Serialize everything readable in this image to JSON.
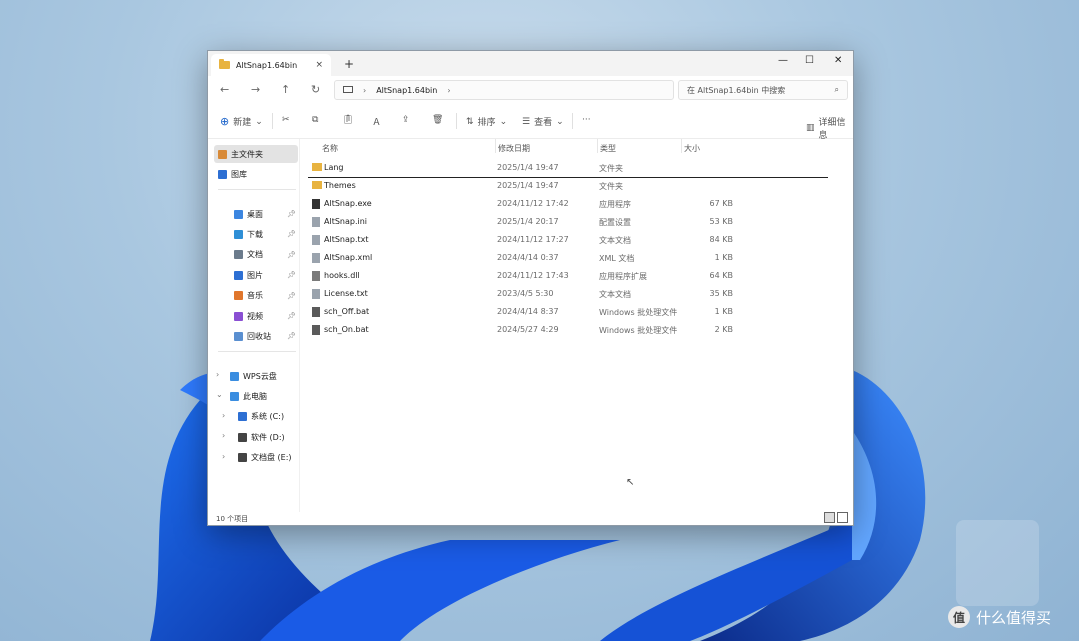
{
  "window": {
    "tab_title": "AltSnap1.64bin",
    "tab_close": "×",
    "tab_add": "+",
    "controls": {
      "minimize": "—",
      "maximize": "☐",
      "close": "✕"
    }
  },
  "nav": {
    "back": "←",
    "forward": "→",
    "up": "↑",
    "refresh": "↻",
    "breadcrumb": [
      "AltSnap1.64bin"
    ],
    "search_placeholder": "在 AltSnap1.64bin 中搜索"
  },
  "toolbar": {
    "new_label": "新建",
    "sort_label": "排序",
    "view_label": "查看",
    "more_label": "···",
    "details_label": "详细信息"
  },
  "sidebar": {
    "top": [
      {
        "label": "主文件夹",
        "icon": "home-icon",
        "color": "#d88a38"
      },
      {
        "label": "图库",
        "icon": "gallery-icon",
        "color": "#2d6fd3"
      }
    ],
    "pinned": [
      {
        "label": "桌面",
        "icon": "desktop-icon",
        "color": "#3c86e0"
      },
      {
        "label": "下载",
        "icon": "download-icon",
        "color": "#2f8fd6"
      },
      {
        "label": "文档",
        "icon": "documents-icon",
        "color": "#6b7b8c"
      },
      {
        "label": "图片",
        "icon": "pictures-icon",
        "color": "#2d6fd3"
      },
      {
        "label": "音乐",
        "icon": "music-icon",
        "color": "#e0762c"
      },
      {
        "label": "视频",
        "icon": "videos-icon",
        "color": "#8a4fd3"
      },
      {
        "label": "回收站",
        "icon": "recycle-bin-icon",
        "color": "#5a8fd0"
      }
    ],
    "tree": [
      {
        "label": "WPS云盘",
        "icon": "cloud-icon",
        "color": "#3a8de0",
        "chev": "›",
        "indent": 0
      },
      {
        "label": "此电脑",
        "icon": "computer-icon",
        "color": "#3a8de0",
        "chev": "⌄",
        "indent": 0
      },
      {
        "label": "系统 (C:)",
        "icon": "drive-icon",
        "color": "#2d6fd3",
        "chev": "›",
        "indent": 1
      },
      {
        "label": "软件 (D:)",
        "icon": "drive-icon",
        "color": "#444444",
        "chev": "›",
        "indent": 1
      },
      {
        "label": "文档盘 (E:)",
        "icon": "drive-icon",
        "color": "#444444",
        "chev": "›",
        "indent": 1
      }
    ]
  },
  "columns": {
    "name": "名称",
    "date": "修改日期",
    "type": "类型",
    "size": "大小"
  },
  "files": [
    {
      "name": "Lang",
      "date": "2025/1/4 19:47",
      "type": "文件夹",
      "size": "",
      "kind": "folder"
    },
    {
      "name": "Themes",
      "date": "2025/1/4 19:47",
      "type": "文件夹",
      "size": "",
      "kind": "folder"
    },
    {
      "name": "AltSnap.exe",
      "date": "2024/11/12 17:42",
      "type": "应用程序",
      "size": "67 KB",
      "kind": "exe"
    },
    {
      "name": "AltSnap.ini",
      "date": "2025/1/4 20:17",
      "type": "配置设置",
      "size": "53 KB",
      "kind": "file"
    },
    {
      "name": "AltSnap.txt",
      "date": "2024/11/12 17:27",
      "type": "文本文档",
      "size": "84 KB",
      "kind": "file"
    },
    {
      "name": "AltSnap.xml",
      "date": "2024/4/14 0:37",
      "type": "XML 文档",
      "size": "1 KB",
      "kind": "file"
    },
    {
      "name": "hooks.dll",
      "date": "2024/11/12 17:43",
      "type": "应用程序扩展",
      "size": "64 KB",
      "kind": "dll"
    },
    {
      "name": "License.txt",
      "date": "2023/4/5 5:30",
      "type": "文本文档",
      "size": "35 KB",
      "kind": "file"
    },
    {
      "name": "sch_Off.bat",
      "date": "2024/4/14 8:37",
      "type": "Windows 批处理文件",
      "size": "1 KB",
      "kind": "bat"
    },
    {
      "name": "sch_On.bat",
      "date": "2024/5/27 4:29",
      "type": "Windows 批处理文件",
      "size": "2 KB",
      "kind": "bat"
    }
  ],
  "status": {
    "count": "10 个项目"
  },
  "watermark": {
    "badge": "值",
    "text": "什么值得买"
  }
}
